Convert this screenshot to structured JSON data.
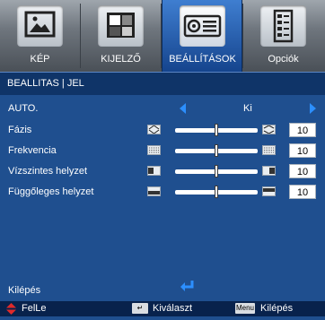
{
  "tabs": [
    {
      "label": "KÉP",
      "icon": "picture-icon",
      "active": false
    },
    {
      "label": "KIJELZŐ",
      "icon": "display-icon",
      "active": false
    },
    {
      "label": "BEÁLLÍTÁSOK",
      "icon": "projector-icon",
      "active": true
    },
    {
      "label": "Opciók",
      "icon": "options-icon",
      "active": false
    }
  ],
  "header": {
    "title": "BEALLITAS | JEL"
  },
  "rows": {
    "auto": {
      "label": "AUTO.",
      "value": "Ki"
    },
    "fazis": {
      "label": "Fázis",
      "value": "10",
      "level": 0.5
    },
    "frekvencia": {
      "label": "Frekvencia",
      "value": "10",
      "level": 0.5
    },
    "vizszintes": {
      "label": "Vízszintes helyzet",
      "value": "10",
      "level": 0.5
    },
    "fuggoleges": {
      "label": "Függőleges helyzet",
      "value": "10",
      "level": 0.5
    }
  },
  "exit": {
    "label": "Kilépés",
    "icon": "enter-arrow-icon"
  },
  "footer": {
    "move_label": "FelLe",
    "select_label": "Kiválaszt",
    "select_key": "↵",
    "exit_label": "Kilépés",
    "exit_key": "Menu"
  },
  "colors": {
    "background": "#1f4f8f",
    "accent": "#2c8fff",
    "active_tab": "#2a6bbd"
  }
}
